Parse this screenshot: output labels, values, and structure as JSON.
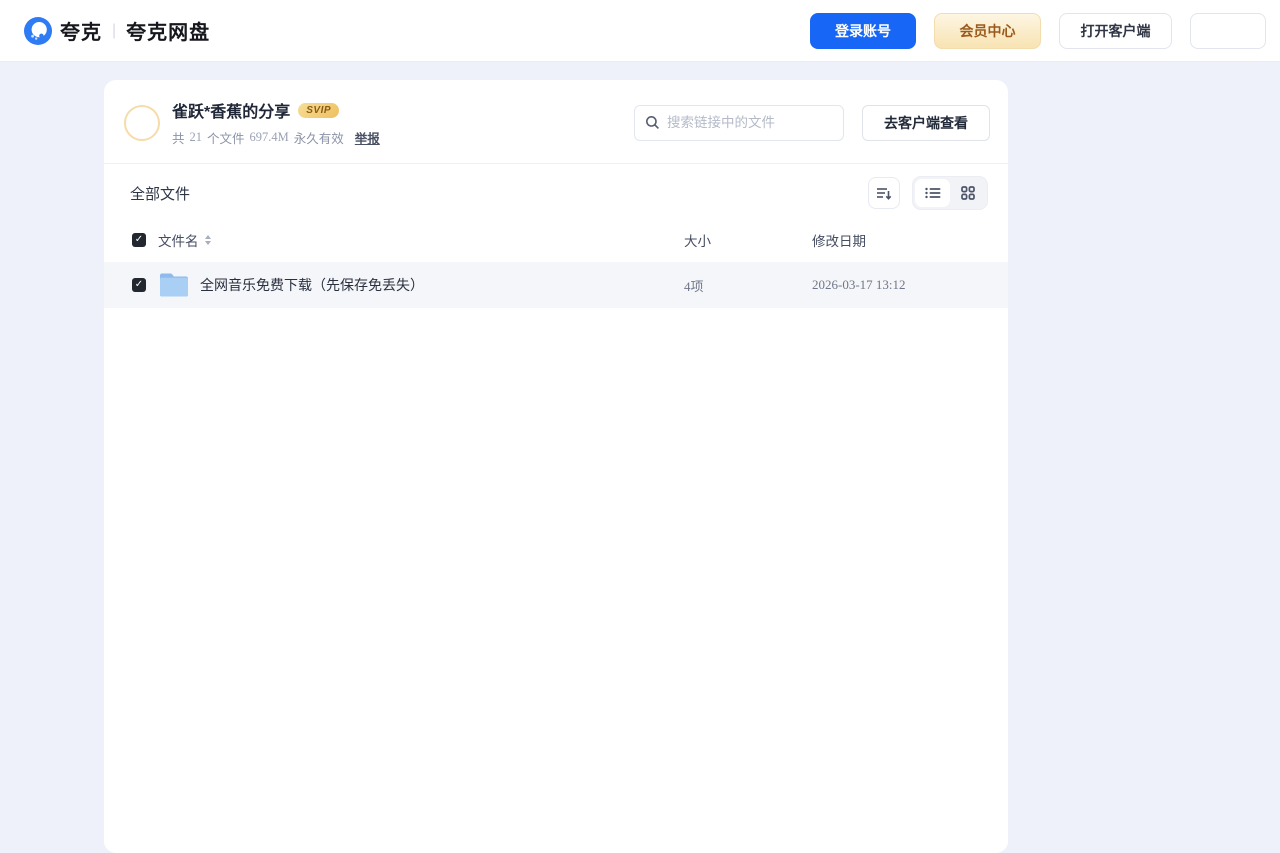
{
  "topbar": {
    "brand_name": "夸克",
    "brand_separator": "|",
    "product_name": "夸克网盘",
    "login_label": "登录账号",
    "vip_label": "会员中心",
    "open_client_label": "打开客户端",
    "empty_button_label": ""
  },
  "share": {
    "title": "雀跃*香蕉的分享",
    "badge": "SVIP",
    "meta_prefix": "共",
    "file_count": "21",
    "meta_files_label": "个文件",
    "total_size": "697.4M",
    "validity": "永久有效",
    "report_label": "举报",
    "search_placeholder": "搜索链接中的文件",
    "open_in_client_label": "去客户端查看"
  },
  "files": {
    "section_title": "全部文件",
    "columns": {
      "name": "文件名",
      "size": "大小",
      "modified": "修改日期"
    },
    "rows": [
      {
        "name": "全网音乐免费下载（先保存免丢失）",
        "size": "4项",
        "modified": "2026-03-17 13:12",
        "type": "folder",
        "checked": true
      }
    ],
    "view_mode": "list",
    "select_all_checked": true
  },
  "colors": {
    "primary_blue": "#1766F6",
    "page_background": "#EEF1FA",
    "vip_button_text": "#9B5A1D",
    "svip_badge_gold": "#EFC261",
    "selected_row_background": "#F5F6F9",
    "folder_blue": "#A9CFF5"
  },
  "icons": {
    "logo": "quark-logo-icon",
    "search": "search-icon",
    "sort": "sort-order-icon",
    "list": "list-view-icon",
    "grid": "grid-view-icon",
    "folder": "folder-icon",
    "checkbox": "checkbox-checked-icon",
    "column_sort": "column-sort-arrows-icon"
  }
}
